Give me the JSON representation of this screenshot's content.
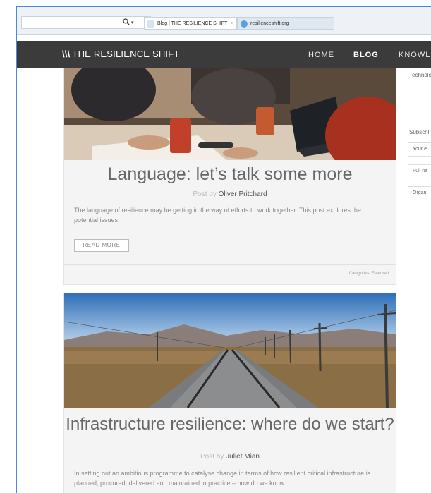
{
  "browser": {
    "address_bar": "",
    "search_icon": "search-icon",
    "active_tab_title": "Blog | THE RESILIENCE SHIFT",
    "active_tab_close": "×",
    "inactive_tab_title": "resilienceshift.org"
  },
  "site": {
    "logo_mark": "\\\\\\",
    "logo_text": "THE RESILIENCE SHIFT",
    "nav": {
      "home": "HOME",
      "blog": "BLOG",
      "knowledge": "KNOWLE"
    }
  },
  "sidebar": {
    "tech_label": "Technolo",
    "subscribe_label": "Subscril",
    "email_placeholder": "Your e",
    "fullname_placeholder": "Full na",
    "organisation_placeholder": "Organi"
  },
  "posts": [
    {
      "title": "Language: let’s talk some more",
      "byline_prefix": "Post by",
      "author": "Oliver Pritchard",
      "excerpt": "The language of resilience may be getting in the way of efforts to work together. This post explores the potential issues.",
      "read_more": "READ MORE",
      "categories": "Categories: Featured"
    },
    {
      "title": "Infrastructure resilience: where do we start?",
      "byline_prefix": "Post by",
      "author": "Juliet Mian",
      "excerpt": "In setting out an ambitious programme to catalyse change in terms of how resilient critical infrastructure is planned, procured, delivered and maintained in practice – how do we know"
    }
  ],
  "colors": {
    "nav_bg": "#3b3b3b",
    "accent_frame": "#4a8ad8",
    "card_bg": "#f4f4f4"
  }
}
